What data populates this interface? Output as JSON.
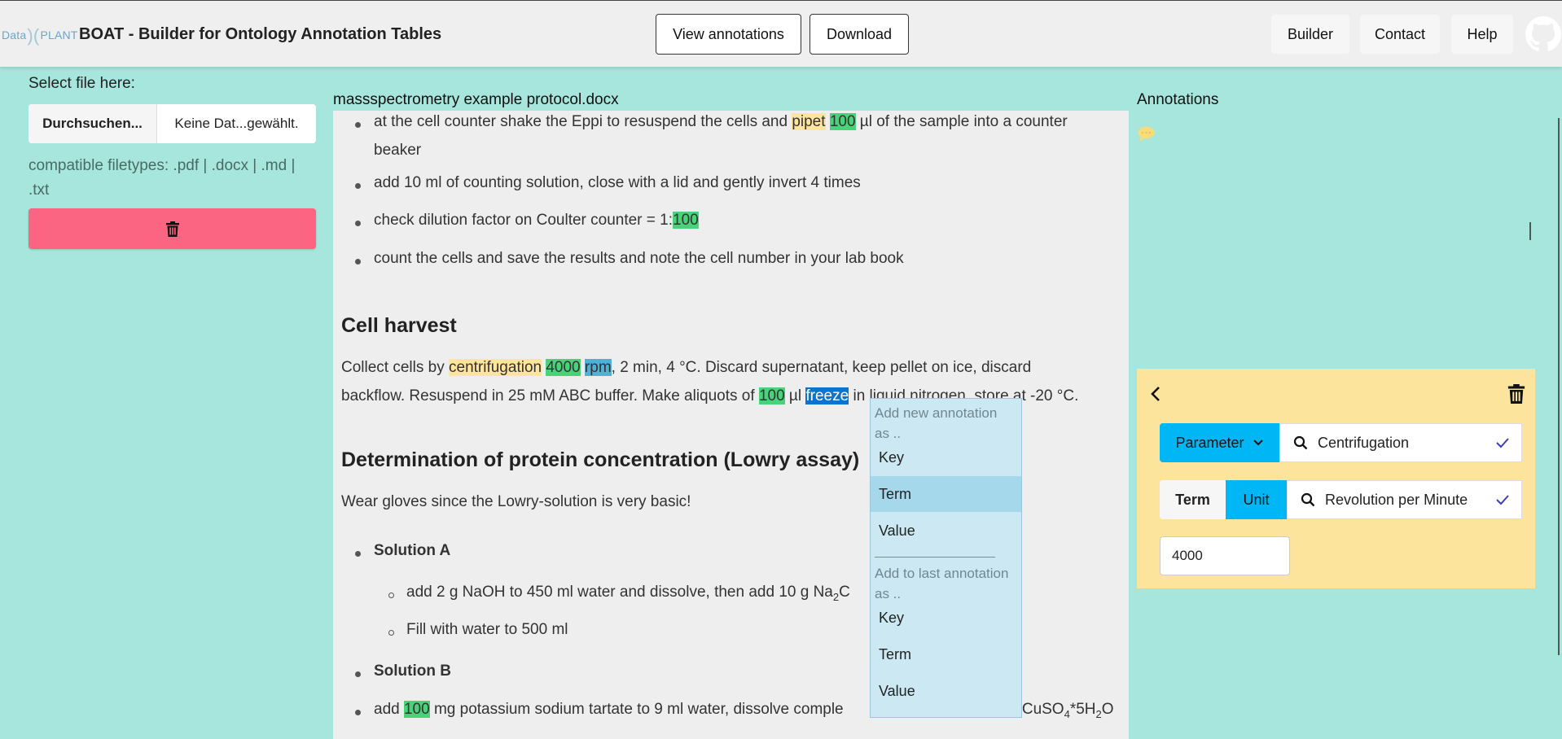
{
  "navbar": {
    "logo_left": "Data",
    "logo_right": "PLANT",
    "title": "BOAT - Builder for Ontology Annotation Tables",
    "view_annotations": "View annotations",
    "download": "Download",
    "links": [
      "Builder",
      "Contact",
      "Help"
    ]
  },
  "sidebar": {
    "select_label": "Select file here:",
    "browse_label": "Durchsuchen...",
    "file_name": "Keine Dat...gewählt.",
    "filetypes_line1": "compatible filetypes: .pdf | .docx | .md |",
    "filetypes_line2": ".txt"
  },
  "document": {
    "filename": "massspectrometry example protocol.docx",
    "list1": {
      "item1_a": "at the cell counter shake the Eppi to resuspend the cells and ",
      "item1_pipet": "pipet",
      "item1_100": "100",
      "item1_b": " µl of the sample into a counter",
      "item1_c": "beaker",
      "item2": "add 10 ml of counting solution, close with a lid and gently invert 4 times",
      "item3_a": "check dilution factor on Coulter counter = 1:",
      "item3_100": "100",
      "item4": "count the cells and save the results and note the cell number in your lab book"
    },
    "section_cell_harvest": "Cell harvest",
    "harvest": {
      "a": "Collect cells by ",
      "centrifugation": "centrifugation",
      "n4000": "4000",
      "rpm": "rpm",
      "b": ", 2 min, 4 °C. Discard supernatant, keep pellet on ice, discard",
      "c": "backflow. Resuspend in 25 mM ABC buffer. Make aliquots of ",
      "n100": "100",
      "d": " µl ",
      "freeze": "freeze",
      "e": " in liquid nitrogen, store at -20 °C."
    },
    "section_lowry": "Determination of protein concentration (Lowry assay)",
    "lowry_intro": "Wear gloves since the Lowry-solution is very basic!",
    "solution_a": "Solution A",
    "sol_a_item1_a": "add 2 g NaOH to 450 ml water and dissolve, then add 10 g Na",
    "sol_a_item1_sub": "2",
    "sol_a_item1_b": "C",
    "sol_a_item2": "Fill with water to 500 ml",
    "solution_b": "Solution B",
    "sol_b_item1_a": "add ",
    "sol_b_item1_100": "100",
    "sol_b_item1_b": " mg potassium sodium tartate to 9 ml water, dissolve comple",
    "sol_b_item1_c": "g CuSO",
    "sol_b_item1_sub4": "4",
    "sol_b_item1_d": "*5H",
    "sol_b_item1_sub2": "2",
    "sol_b_item1_e": "O"
  },
  "context_menu": {
    "header_new_line1": "Add new annotation",
    "header_new_line2": "as ..",
    "new_key": "Key",
    "new_term": "Term",
    "new_value": "Value",
    "header_last_line1": "Add to last annotation",
    "header_last_line2": "as ..",
    "last_key": "Key",
    "last_term": "Term",
    "last_value": "Value"
  },
  "annotations": {
    "title": "Annotations",
    "card": {
      "type_label": "Parameter",
      "key_value": "Centrifugation",
      "tab_term": "Term",
      "tab_unit": "Unit",
      "unit_value": "Revolution per Minute",
      "value": "4000"
    }
  },
  "colors": {
    "page_bg": "#a6e6dc",
    "delete_red": "#fb6581",
    "accent_blue": "#00b6f5",
    "card_yellow": "#fde49c"
  }
}
